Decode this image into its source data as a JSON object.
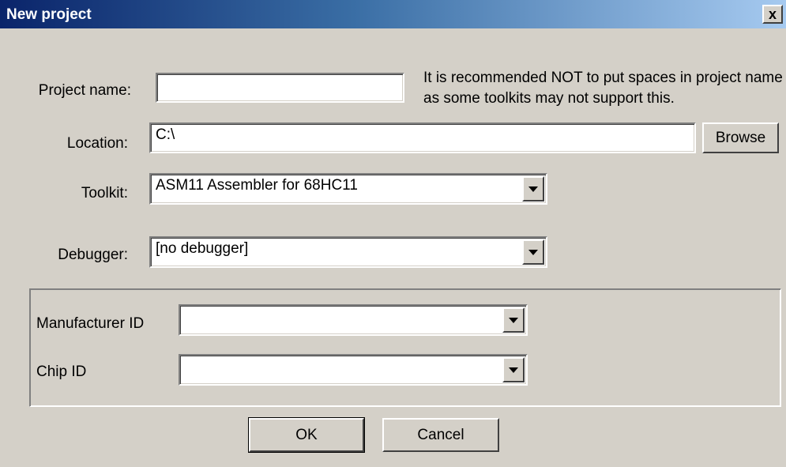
{
  "window": {
    "title": "New project",
    "close_glyph": "x"
  },
  "form": {
    "project_name": {
      "label": "Project name:",
      "value": ""
    },
    "note": "It is recommended NOT to put spaces in project name as some toolkits may not support this.",
    "location": {
      "label": "Location:",
      "value": "C:\\",
      "browse_label": "Browse"
    },
    "toolkit": {
      "label": "Toolkit:",
      "value": "ASM11 Assembler for 68HC11"
    },
    "debugger": {
      "label": "Debugger:",
      "value": "[no debugger]"
    }
  },
  "chip_group": {
    "manufacturer": {
      "label": "Manufacturer ID",
      "value": ""
    },
    "chip": {
      "label": "Chip ID",
      "value": ""
    }
  },
  "buttons": {
    "ok_label": "OK",
    "cancel_label": "Cancel"
  },
  "colors": {
    "titlebar_start": "#0a246a",
    "titlebar_end": "#a6caf0",
    "dialog_bg": "#d4d0c8"
  }
}
